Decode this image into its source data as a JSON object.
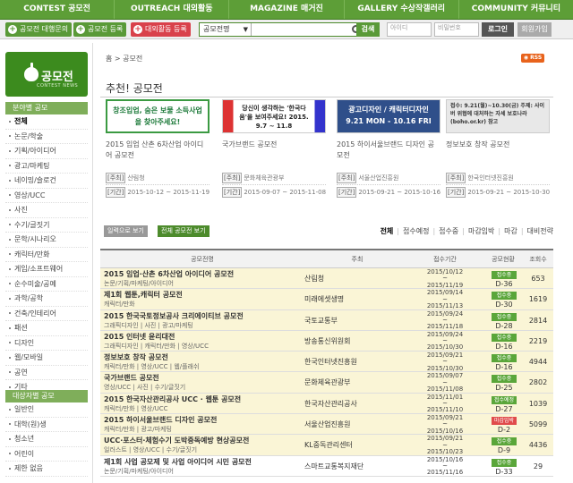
{
  "topnav": [
    {
      "label": "CONTEST 공모전"
    },
    {
      "label": "OUTREACH 대외활동"
    },
    {
      "label": "MAGAZINE 매거진"
    },
    {
      "label": "GALLERY 수상작갤러리"
    },
    {
      "label": "COMMUNITY 커뮤니티"
    }
  ],
  "toolbar": {
    "btn_inquiry": "공모전 대행문의",
    "btn_register": "공모전 등록",
    "btn_outreach_register": "대외활동 등록",
    "search_select": "공모전명",
    "search_placeholder": "",
    "search_button": "검색",
    "id_placeholder": "아이디",
    "pw_placeholder": "비밀번호",
    "login": "로그인",
    "join": "회원가입"
  },
  "sidebar": {
    "logo_title": "공모전",
    "logo_sub": "CONTEST NEWS",
    "section1": "분야별 공모",
    "categories": [
      "전체",
      "논문/학술",
      "기획/아이디어",
      "광고/마케팅",
      "네이밍/슬로건",
      "영상/UCC",
      "사진",
      "수기/글짓기",
      "문학/시나리오",
      "캐릭터/만화",
      "게임/소프트웨어",
      "순수미술/공예",
      "과학/공학",
      "건축/인테리어",
      "패션",
      "디자인",
      "웹/모바일",
      "공연",
      "기타"
    ],
    "section2": "대상자별 공모",
    "targets": [
      "일반인",
      "대학(원)생",
      "청소년",
      "어린이",
      "제한 없음"
    ]
  },
  "main": {
    "breadcrumb": "홈 > 공모전",
    "rss": "RSS",
    "section_title": "추천! 공모전",
    "cards": [
      {
        "banner": "창조입업, 숨은 보물 소득사업을 찾아주세요!",
        "title": "2015 입업 산촌 6차산업 아이디어 공모전",
        "host_tag": "[주최]",
        "host": "산림청",
        "period_tag": "[기간]",
        "period": "2015-10-12 ~ 2015-11-19"
      },
      {
        "banner": "당신이 생각하는 '한국다움'을 보여주세요! 2015. 9.7 ~ 11.8",
        "title": "국가브랜드 공모전",
        "host_tag": "[주최]",
        "host": "문화체육관광부",
        "period_tag": "[기간]",
        "period": "2015-09-07 ~ 2015-11-08"
      },
      {
        "banner": "광고디자인 / 캐릭터디자인 9.21 MON - 10.16 FRI",
        "title": "2015 하이서울브랜드 디자인 공모전",
        "host_tag": "[주최]",
        "host": "서울산업진흥원",
        "period_tag": "[기간]",
        "period": "2015-09-21 ~ 2015-10-16"
      },
      {
        "banner": "접수: 9.21(월)~10.30(금) 주제: 사이버 위협에 대처하는 자세 보호나라 (boho.or.kr) 참고",
        "title": "정보보호 창작 공모전",
        "host_tag": "[주최]",
        "host": "한국인터넷진흥원",
        "period_tag": "[기간]",
        "period": "2015-09-21 ~ 2015-10-30"
      }
    ],
    "view_btn1": "일력으로 보기",
    "view_btn2": "전체 공모전 보기",
    "filters": [
      "전체",
      "접수예정",
      "접수중",
      "마감임박",
      "마감",
      "대비전략"
    ],
    "table_headers": {
      "name": "공모전명",
      "host": "주최",
      "period": "접수기간",
      "status": "공모현황",
      "views": "조회수"
    },
    "rows": [
      {
        "title": "2015 임업·산촌 6차산업 아이디어 공모전",
        "cats": "논문/기획/마케팅/아이디어",
        "host": "산림청",
        "d1": "2015/10/12",
        "d2": "~",
        "d3": "2015/11/19",
        "status": "접수중",
        "dday": "D-36",
        "views": "653"
      },
      {
        "title": "제1회 웹툰,캐릭터 공모전",
        "cats": "캐릭터/만화",
        "host": "미래에셋생명",
        "d1": "2015/09/14",
        "d2": "~",
        "d3": "2015/11/13",
        "status": "접수중",
        "dday": "D-30",
        "views": "1619"
      },
      {
        "title": "2015 한국국토정보공사 크리에이티브 공모전",
        "cats": "그래픽디자인 | 사진 | 광고/마케팅",
        "host": "국토교통부",
        "d1": "2015/09/24",
        "d2": "~",
        "d3": "2015/11/18",
        "status": "접수중",
        "dday": "D-28",
        "views": "2814"
      },
      {
        "title": "2015 인터넷 윤리대전",
        "cats": "그래픽디자인 | 캐릭터/만화 | 영상/UCC",
        "host": "방송통신위원회",
        "d1": "2015/09/24",
        "d2": "~",
        "d3": "2015/10/30",
        "status": "접수중",
        "dday": "D-16",
        "views": "2219"
      },
      {
        "title": "정보보호 창작 공모전",
        "cats": "캐릭터/만화 | 영상/UCC | 웹/플래쉬",
        "host": "한국인터넷진흥원",
        "d1": "2015/09/21",
        "d2": "~",
        "d3": "2015/10/30",
        "status": "접수중",
        "dday": "D-16",
        "views": "4944"
      },
      {
        "title": "국가브랜드 공모전",
        "cats": "영상/UCC | 사진 | 수기/글짓기",
        "host": "문화체육관광부",
        "d1": "2015/09/07",
        "d2": "~",
        "d3": "2015/11/08",
        "status": "접수중",
        "dday": "D-25",
        "views": "2802"
      },
      {
        "title": "2015 한국자산관리공사 UCC · 웹툰 공모전",
        "cats": "캐릭터/만화 | 영상/UCC",
        "host": "한국자산관리공사",
        "d1": "2015/11/01",
        "d2": "~",
        "d3": "2015/11/10",
        "status": "접수예정",
        "dday": "D-27",
        "views": "1039"
      },
      {
        "title": "2015 하이서울브랜드 디자인 공모전",
        "cats": "캐릭터/만화 | 광고/마케팅",
        "host": "서울산업진흥원",
        "d1": "2015/09/21",
        "d2": "~",
        "d3": "2015/10/16",
        "status": "마감임박",
        "dday": "D-2",
        "views": "5099"
      },
      {
        "title": "UCC·포스터·체험수기 도박중독예방 현상공모전",
        "cats": "일러스트 | 영상/UCC | 수기/글짓기",
        "host": "KL중독관리센터",
        "d1": "2015/09/21",
        "d2": "~",
        "d3": "2015/10/23",
        "status": "접수중",
        "dday": "D-9",
        "views": "4436"
      },
      {
        "title": "제1회 사업 공모제 및 사업 아이디어 시민 공모전",
        "cats": "논문/기획/마케팅/아이디어",
        "host": "스마트교통복지재단",
        "d1": "2015/10/16",
        "d2": "~",
        "d3": "2015/11/16",
        "status": "접수중",
        "dday": "D-33",
        "views": "29"
      }
    ]
  },
  "colors": {
    "nav_green": "#5d9e37",
    "accent_green": "#5a9a38",
    "accent_red": "#d9414b",
    "row_yellow": "#faf5d6"
  }
}
